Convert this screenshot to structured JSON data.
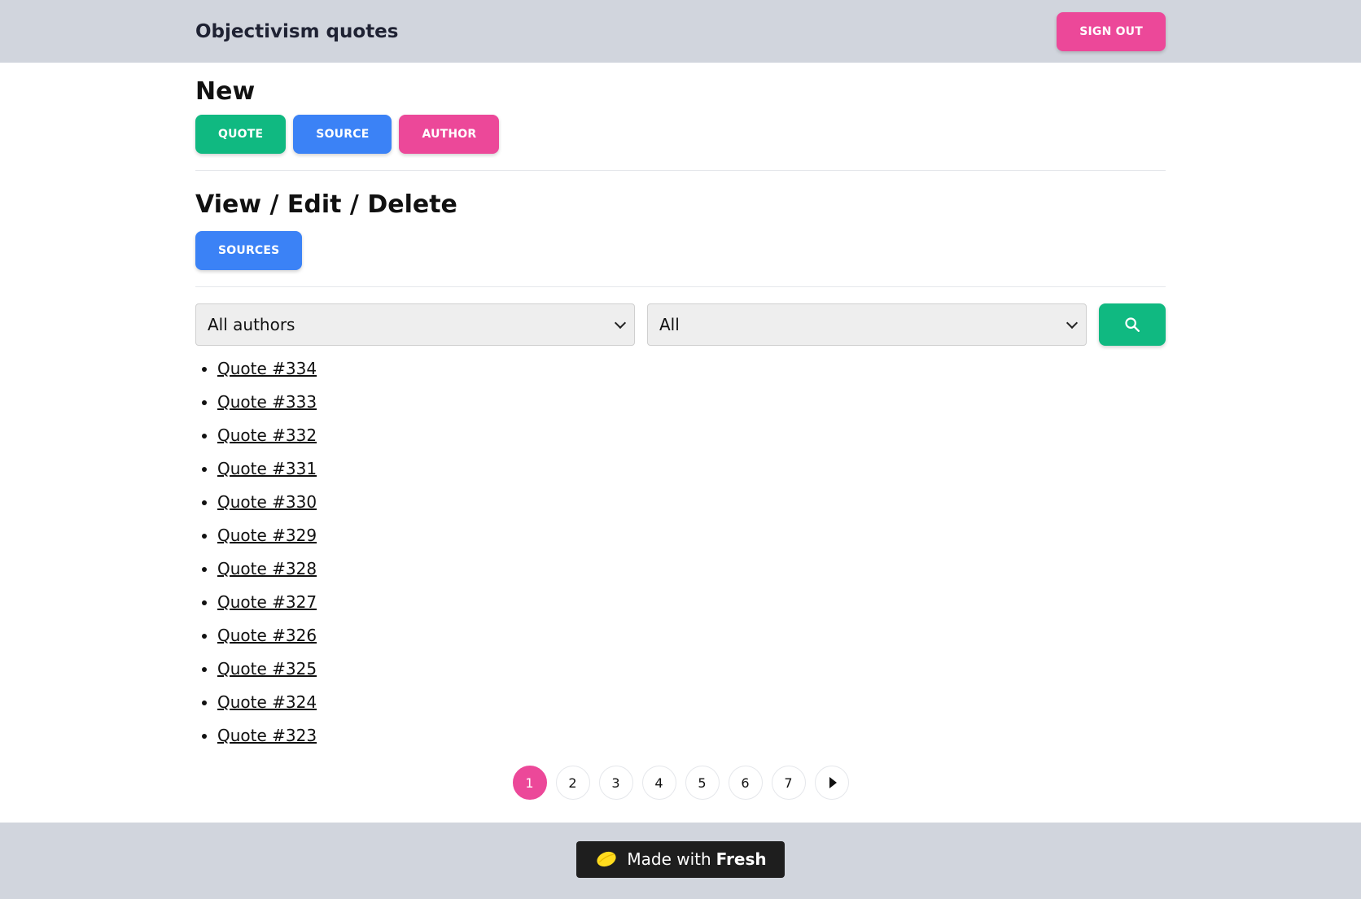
{
  "header": {
    "title": "Objectivism quotes",
    "sign_out_label": "SIGN OUT"
  },
  "new_section": {
    "heading": "New",
    "buttons": [
      {
        "label": "QUOTE",
        "color": "#10b981"
      },
      {
        "label": "SOURCE",
        "color": "#3b82f6"
      },
      {
        "label": "AUTHOR",
        "color": "#ec4899"
      }
    ]
  },
  "view_section": {
    "heading": "View / Edit / Delete",
    "sources_label": "SOURCES"
  },
  "filters": {
    "author_select_value": "All authors",
    "type_select_value": "All",
    "search_icon": "search-icon"
  },
  "quotes": [
    "Quote #334",
    "Quote #333",
    "Quote #332",
    "Quote #331",
    "Quote #330",
    "Quote #329",
    "Quote #328",
    "Quote #327",
    "Quote #326",
    "Quote #325",
    "Quote #324",
    "Quote #323"
  ],
  "pagination": {
    "pages": [
      "1",
      "2",
      "3",
      "4",
      "5",
      "6",
      "7"
    ],
    "current": "1",
    "next_icon": "next-page-icon"
  },
  "footer": {
    "made_with": "Made with",
    "brand": "Fresh"
  },
  "colors": {
    "accent_pink": "#ec4899",
    "accent_green": "#10b981",
    "accent_blue": "#3b82f6",
    "chrome_gray": "#d1d5dd"
  }
}
